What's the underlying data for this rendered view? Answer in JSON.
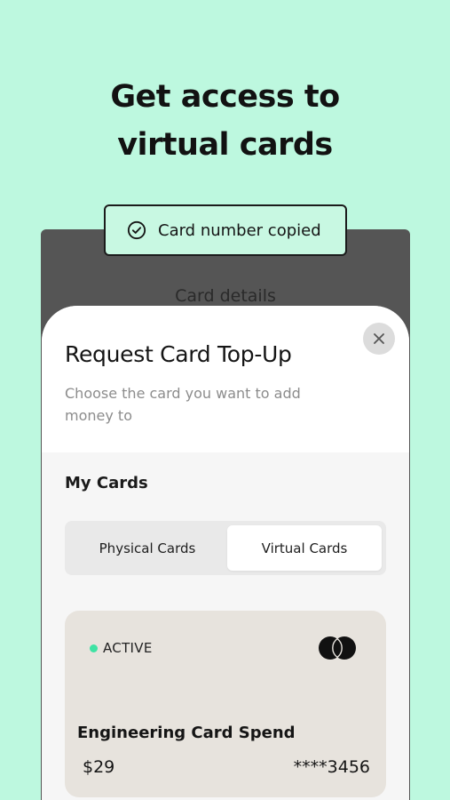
{
  "headline": {
    "line1": "Get access to",
    "line2": "virtual cards"
  },
  "background_screen": {
    "title": "Card details"
  },
  "toast": {
    "icon": "check-circle-icon",
    "text": "Card number copied"
  },
  "sheet": {
    "close_icon": "close-icon",
    "title": "Request Card Top-Up",
    "subtitle_line1": "Choose the card you want to add",
    "subtitle_line2": "money to",
    "section_label": "My Cards",
    "tabs": [
      {
        "label": "Physical Cards",
        "selected": false
      },
      {
        "label": "Virtual Cards",
        "selected": true
      }
    ],
    "card": {
      "status": "ACTIVE",
      "status_color": "#3fe3a4",
      "brand_icon": "mastercard-logo-icon",
      "name": "Engineering Card Spend",
      "amount": "$29",
      "number": "****3456"
    }
  },
  "colors": {
    "background": "#bdf8df",
    "toast_background": "#c8f8e2",
    "card_background": "#e7e3dd"
  }
}
